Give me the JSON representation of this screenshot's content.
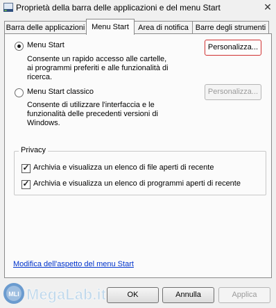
{
  "window": {
    "title": "Proprietà della barra delle applicazioni e del menu Start",
    "close_glyph": "✕"
  },
  "tabs": [
    {
      "label": "Barra delle applicazioni"
    },
    {
      "label": "Menu Start"
    },
    {
      "label": "Area di notifica"
    },
    {
      "label": "Barre degli strumenti"
    }
  ],
  "options": {
    "start_menu": {
      "label": "Menu Start",
      "description": "Consente un rapido accesso alle cartelle, ai programmi preferiti e alle funzionalità di ricerca.",
      "button": "Personalizza...",
      "selected": true
    },
    "classic_menu": {
      "label": "Menu Start classico",
      "description": "Consente di utilizzare l'interfaccia e le funzionalità delle precedenti versioni di Windows.",
      "button": "Personalizza...",
      "selected": false
    }
  },
  "privacy": {
    "title": "Privacy",
    "items": [
      {
        "label": "Archivia e visualizza un elenco di file aperti di recente",
        "checked": true
      },
      {
        "label": "Archivia e visualizza un elenco di programmi aperti di recente",
        "checked": true
      }
    ]
  },
  "link": "Modifica dell'aspetto del menu Start",
  "buttons": {
    "ok": "OK",
    "cancel": "Annulla",
    "apply": "Applica"
  },
  "watermark": "MegaLab.it",
  "colors": {
    "focus_border": "#d03030",
    "link": "#0033cc"
  }
}
